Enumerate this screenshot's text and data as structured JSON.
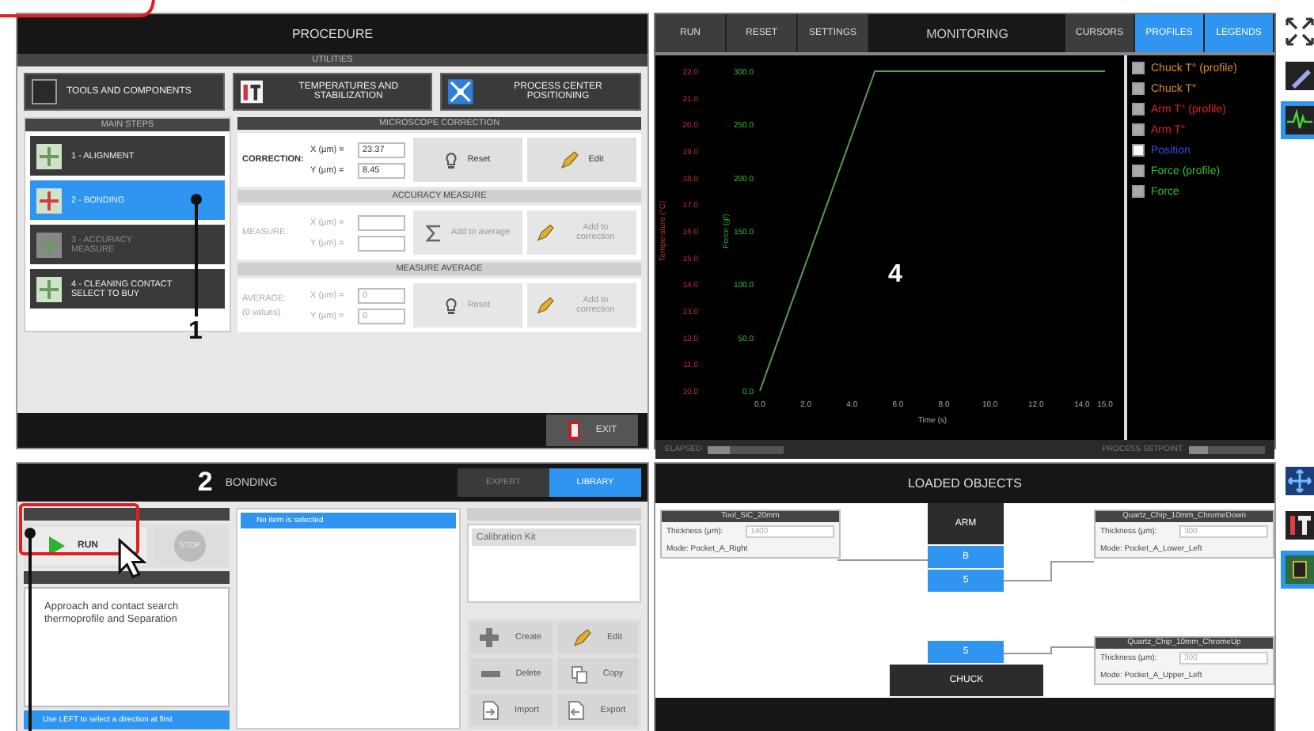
{
  "procedure": {
    "title": "PROCEDURE",
    "utilities": {
      "title": "UTILITIES",
      "buttons": [
        {
          "label": "TOOLS AND COMPONENTS",
          "kind": "tools"
        },
        {
          "label": "TEMPERATURES AND STABILIZATION",
          "kind": "temperature"
        },
        {
          "label": "PROCESS CENTER POSITIONING",
          "kind": "center"
        }
      ]
    },
    "main_steps": {
      "title": "MAIN STEPS",
      "items": [
        {
          "label": "1 - ALIGNMENT",
          "selected": false,
          "disabled": false
        },
        {
          "label": "2 - BONDING",
          "selected": true,
          "disabled": false
        },
        {
          "label": "3 - ACCURACY MEASURE",
          "selected": false,
          "disabled": true
        },
        {
          "label": "4 - CLEANING CONTACT SELECT TO BUY",
          "selected": false,
          "disabled": false
        }
      ]
    },
    "microscope": {
      "title": "MICROSCOPE CORRECTION",
      "sections": [
        {
          "label": "CORRECTION:",
          "disabled": false,
          "fields": [
            {
              "label": "X (µm) =",
              "value": "23.37"
            },
            {
              "label": "Y (µm) =",
              "value": "8.45"
            }
          ],
          "buttons": [
            {
              "label": "Reset",
              "kind": "reset"
            },
            {
              "label": "Edit",
              "kind": "edit"
            }
          ]
        },
        {
          "title": "ACCURACY MEASURE",
          "label": "MEASURE:",
          "disabled": true,
          "fields": [
            {
              "label": "X (µm) ="
            },
            {
              "label": "Y (µm) ="
            }
          ],
          "buttons": [
            {
              "label": "Add to average",
              "kind": "sum"
            },
            {
              "label": "Add to correction",
              "kind": "edit"
            }
          ]
        },
        {
          "title": "MEASURE AVERAGE",
          "label": "AVERAGE:",
          "note": "(0 values)",
          "disabled": true,
          "fields": [
            {
              "label": "X (µm) =",
              "value": "0"
            },
            {
              "label": "Y (µm) =",
              "value": "0"
            }
          ],
          "buttons": [
            {
              "label": "Reset",
              "kind": "reset"
            },
            {
              "label": "Add to correction",
              "kind": "edit"
            }
          ]
        }
      ]
    },
    "exit": {
      "label": "EXIT"
    }
  },
  "monitoring": {
    "title": "MONITORING",
    "buttons": [
      {
        "label": "RUN"
      },
      {
        "label": "RESET"
      },
      {
        "label": "SETTINGS"
      }
    ],
    "toggles": [
      {
        "label": "CURSORS",
        "selected": false
      },
      {
        "label": "PROFILES",
        "selected": true
      },
      {
        "label": "LEGENDS",
        "selected": true
      }
    ],
    "chart_data": {
      "type": "line",
      "xlabel": "Time (s)",
      "ylabel": "Force (gf)",
      "y2label": "Temperature (°C)",
      "xlim": [
        0,
        15
      ],
      "ylim": [
        0,
        300
      ],
      "y2lim": [
        10,
        22
      ],
      "xticks": [
        {
          "value": 0,
          "label": "0.0"
        },
        {
          "value": 2,
          "label": "2.0"
        },
        {
          "value": 4,
          "label": "4.0"
        },
        {
          "value": 6,
          "label": "6.0"
        },
        {
          "value": 8,
          "label": "8.0"
        },
        {
          "value": 10,
          "label": "10.0"
        },
        {
          "value": 12,
          "label": "12.0"
        },
        {
          "value": 14,
          "label": "14.0"
        },
        {
          "value": 15,
          "label": "15.0"
        }
      ],
      "y2ticks": [
        {
          "value": 22,
          "label": "22.0"
        },
        {
          "value": 21,
          "label": "21.0"
        },
        {
          "value": 20,
          "label": "20.0"
        },
        {
          "value": 19,
          "label": "19.0"
        },
        {
          "value": 18,
          "label": "18.0"
        },
        {
          "value": 17,
          "label": "17.0"
        },
        {
          "value": 16,
          "label": "16.0"
        },
        {
          "value": 15,
          "label": "15.0"
        },
        {
          "value": 14,
          "label": "14.0"
        },
        {
          "value": 13,
          "label": "13.0"
        },
        {
          "value": 12,
          "label": "12.0"
        },
        {
          "value": 11,
          "label": "11.0"
        },
        {
          "value": 10,
          "label": "10.0"
        }
      ],
      "yticks": [
        {
          "value": 300,
          "label": "300.0"
        },
        {
          "value": 250,
          "label": "250.0"
        },
        {
          "value": 200,
          "label": "200.0"
        },
        {
          "value": 150,
          "label": "150.0"
        },
        {
          "value": 100,
          "label": "100.0"
        },
        {
          "value": 50,
          "label": "50.0"
        },
        {
          "value": 0,
          "label": "0.0"
        }
      ],
      "x": [
        0,
        5,
        15
      ],
      "series": [
        {
          "color": "#5a9a5a",
          "values": [
            0,
            300,
            300
          ]
        }
      ]
    },
    "legend": [
      {
        "label": "Chuck T° (profile)",
        "color": "#e08a1e",
        "checked": true
      },
      {
        "label": "Chuck T°",
        "color": "#e08a1e",
        "checked": true
      },
      {
        "label": "Arm T° (profile)",
        "color": "#e02020",
        "checked": true
      },
      {
        "label": "Arm T°",
        "color": "#e02020",
        "checked": true
      },
      {
        "label": "Position",
        "color": "#3050e0",
        "checked": false
      },
      {
        "label": "Force (profile)",
        "color": "#30c030",
        "checked": true
      },
      {
        "label": "Force",
        "color": "#30c030",
        "checked": true
      }
    ],
    "status": [
      {
        "label": "ELAPSED",
        "level": 0.3
      },
      {
        "label": "PROCESS SETPOINT",
        "level": 0.25
      }
    ],
    "annotation": "4"
  },
  "bonding": {
    "number": "2",
    "title": "BONDING",
    "tabs": [
      {
        "label": "EXPERT",
        "selected": false
      },
      {
        "label": "LIBRARY",
        "selected": true
      }
    ],
    "run": {
      "label": "RUN"
    },
    "stop": {
      "label": "STOP"
    },
    "description": "Approach and contact search thermoprofile and Separation",
    "hint": "Use LEFT to select a direction at first",
    "list": [
      {
        "label": "No item is selected",
        "selected": true
      }
    ],
    "recipe": "Calibration Kit",
    "actions": [
      {
        "label": "Create",
        "kind": "create"
      },
      {
        "label": "Edit",
        "kind": "edit"
      },
      {
        "label": "Delete",
        "kind": "delete"
      },
      {
        "label": "Copy",
        "kind": "copy"
      },
      {
        "label": "Import",
        "kind": "import"
      },
      {
        "label": "Export",
        "kind": "export"
      }
    ]
  },
  "loaded_objects": {
    "title": "LOADED OBJECTS",
    "cards": [
      {
        "name": "Tool_SiC_20mm",
        "thickness_label": "Thickness (µm):",
        "thickness": "1400",
        "mode": "Mode: Pocket_A_Right"
      },
      {
        "name": "Quartz_Chip_10mm_ChromeDown",
        "thickness_label": "Thickness (µm):",
        "thickness": "300",
        "mode": "Mode: Pocket_A_Lower_Left"
      },
      {
        "name": "Quartz_Chip_10mm_ChromeUp",
        "thickness_label": "Thickness (µm):",
        "thickness": "300",
        "mode": "Mode: Pocket_A_Upper_Left"
      }
    ],
    "arm": "ARM",
    "arm_slots": [
      "B",
      "5"
    ],
    "chuck": "CHUCK",
    "chuck_slots": [
      "5"
    ]
  },
  "toolbar": {
    "top": [
      {
        "kind": "expand",
        "selected": false
      },
      {
        "kind": "probe",
        "selected": false
      },
      {
        "kind": "monitor",
        "selected": true
      }
    ],
    "bottom": [
      {
        "kind": "move",
        "selected": false
      },
      {
        "kind": "thermometer",
        "selected": false
      },
      {
        "kind": "chip",
        "selected": true
      }
    ]
  },
  "annotations": [
    {
      "label": "1"
    }
  ]
}
